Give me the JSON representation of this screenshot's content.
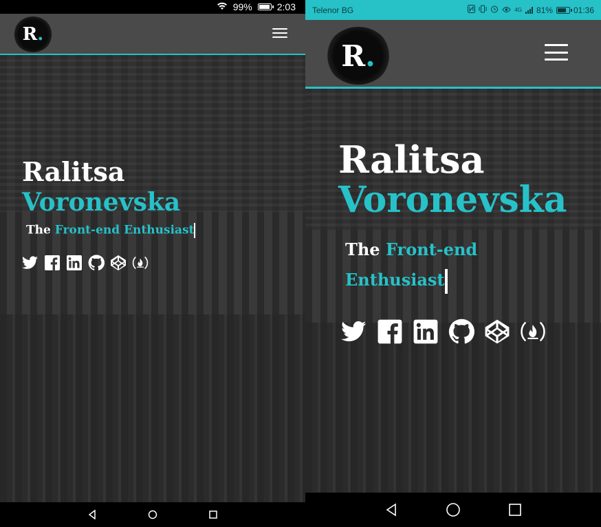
{
  "left_phone": {
    "status": {
      "battery": "99%",
      "time": "2:03",
      "battery_level": 0.99
    },
    "logo": {
      "letter": "R",
      "dot": "."
    },
    "hero": {
      "first_name": "Ralitsa",
      "last_name": "Voronevska",
      "tagline_prefix": "The ",
      "tagline_highlight": "Front-end Enthusiast"
    }
  },
  "right_phone": {
    "status": {
      "carrier": "Telenor BG",
      "network": "4G",
      "battery": "81%",
      "time": "01:36",
      "battery_level": 0.81
    },
    "logo": {
      "letter": "R",
      "dot": "."
    },
    "hero": {
      "first_name": "Ralitsa",
      "last_name": "Voronevska",
      "tagline_prefix": "The ",
      "tagline_highlight": "Front-end Enthusiast"
    }
  },
  "social_icons": [
    "twitter-icon",
    "facebook-icon",
    "linkedin-icon",
    "github-icon",
    "codepen-icon",
    "freecodecamp-icon"
  ],
  "colors": {
    "accent": "#27c1c8",
    "appbar": "#4a4a4a",
    "status_bar_right": "#27c1c8",
    "text": "#ffffff"
  }
}
